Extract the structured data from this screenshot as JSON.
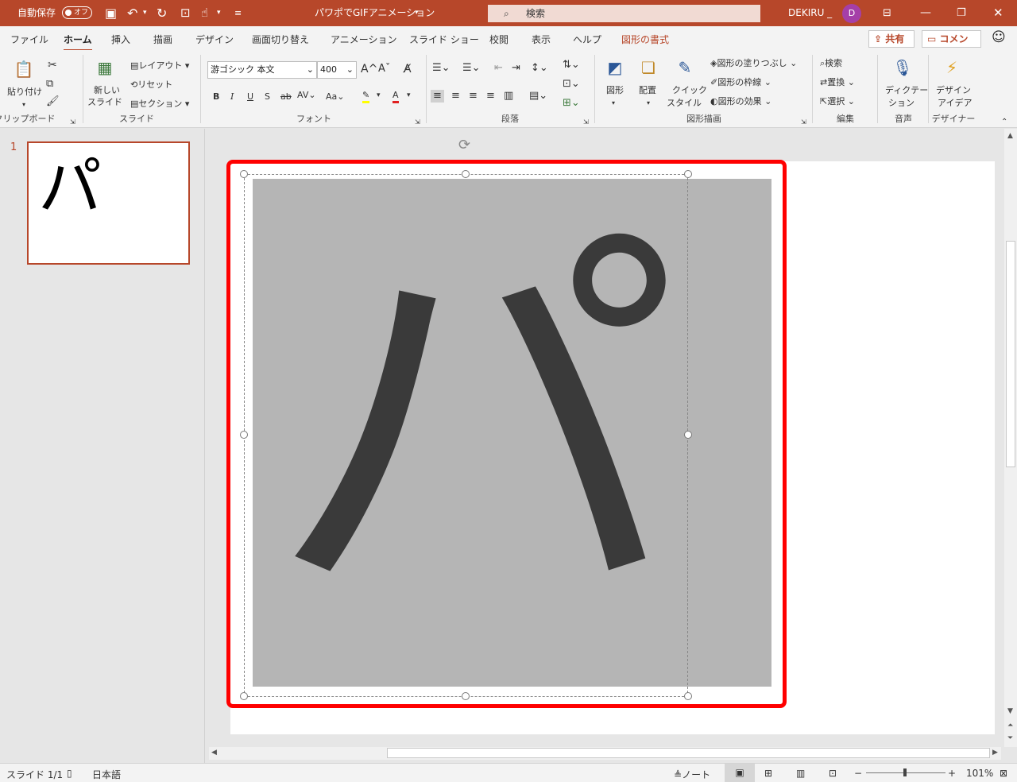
{
  "titlebar": {
    "autosave_label": "自動保存",
    "autosave_state": "オフ",
    "doc_title": "パワポでGIFアニメーション",
    "search_placeholder": "検索",
    "user_name": "DEKIRU _",
    "avatar_initial": "D"
  },
  "tabs": [
    "ファイル",
    "ホーム",
    "挿入",
    "描画",
    "デザイン",
    "画面切り替え",
    "アニメーション",
    "スライド ショー",
    "校閲",
    "表示",
    "ヘルプ",
    "図形の書式"
  ],
  "header_buttons": {
    "share": "共有",
    "comment": "コメント"
  },
  "ribbon": {
    "clipboard": {
      "paste": "貼り付け",
      "group": "クリップボード"
    },
    "slides": {
      "new_slide_1": "新しい",
      "new_slide_2": "スライド",
      "layout": "レイアウト",
      "reset": "リセット",
      "section": "セクション",
      "group": "スライド"
    },
    "font": {
      "name": "游ゴシック 本文",
      "size": "400",
      "group": "フォント",
      "bold": "B",
      "italic": "I",
      "underline": "U",
      "shadow": "S",
      "strike": "ab",
      "spacing": "AV",
      "case": "Aa",
      "grow": "A",
      "shrink": "A",
      "color": "A"
    },
    "paragraph": {
      "group": "段落"
    },
    "drawing": {
      "shapes": "図形",
      "arrange": "配置",
      "quick_1": "クイック",
      "quick_2": "スタイル",
      "fill": "図形の塗りつぶし",
      "outline": "図形の枠線",
      "effects": "図形の効果",
      "group": "図形描画"
    },
    "editing": {
      "find": "検索",
      "replace": "置換",
      "select": "選択",
      "group": "編集"
    },
    "voice": {
      "dictate_1": "ディクテー",
      "dictate_2": "ション",
      "group": "音声"
    },
    "designer": {
      "ideas_1": "デザイン",
      "ideas_2": "アイデア",
      "group": "デザイナー"
    }
  },
  "slides_pane": {
    "number": "1",
    "thumb_text": "パ"
  },
  "slide": {
    "big_text": "パ"
  },
  "statusbar": {
    "slide_count": "スライド 1/1",
    "language": "日本語",
    "notes": "ノート",
    "zoom": "101%",
    "zoom_value_percent": 101
  },
  "colors": {
    "accent": "#b7472a",
    "highlight_frame": "#ff0000",
    "picture_bg": "#b5b5b5",
    "glyph": "#3a3a3a"
  }
}
